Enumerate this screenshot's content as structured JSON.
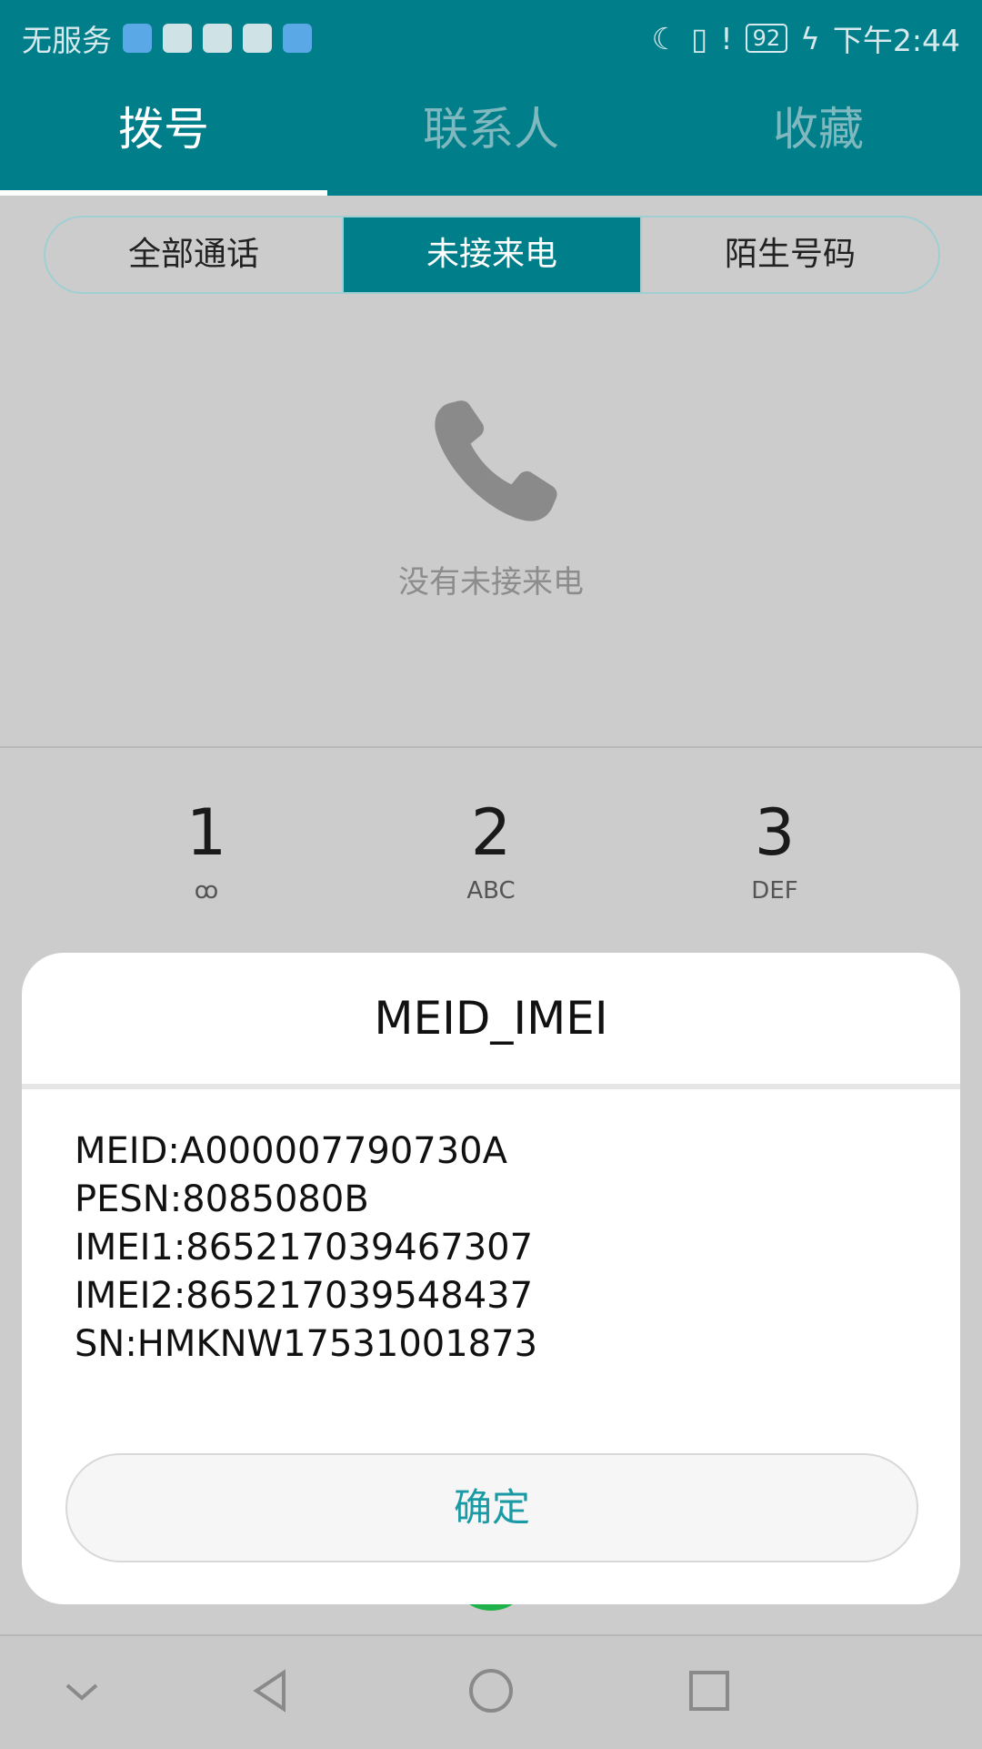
{
  "status_bar": {
    "carrier": "无服务",
    "battery": "92",
    "time": "下午2:44"
  },
  "tabs": [
    {
      "label": "拨号",
      "active": true
    },
    {
      "label": "联系人",
      "active": false
    },
    {
      "label": "收藏",
      "active": false
    }
  ],
  "segments": [
    {
      "label": "全部通话",
      "active": false
    },
    {
      "label": "未接来电",
      "active": true
    },
    {
      "label": "陌生号码",
      "active": false
    }
  ],
  "empty_state": {
    "text": "没有未接来电",
    "icon": "phone-icon"
  },
  "dialpad": [
    {
      "num": "1",
      "sub": "ꝏ"
    },
    {
      "num": "2",
      "sub": "ABC"
    },
    {
      "num": "3",
      "sub": "DEF"
    }
  ],
  "dialog": {
    "title": "MEID_IMEI",
    "lines": [
      "MEID:A000007790730A",
      "PESN:8085080B",
      "IMEI1:865217039467307",
      "IMEI2:865217039548437",
      "SN:HMKNW17531001873"
    ],
    "confirm_label": "确定"
  },
  "colors": {
    "accent": "#007e8a",
    "confirm_text": "#1a9aa5"
  }
}
